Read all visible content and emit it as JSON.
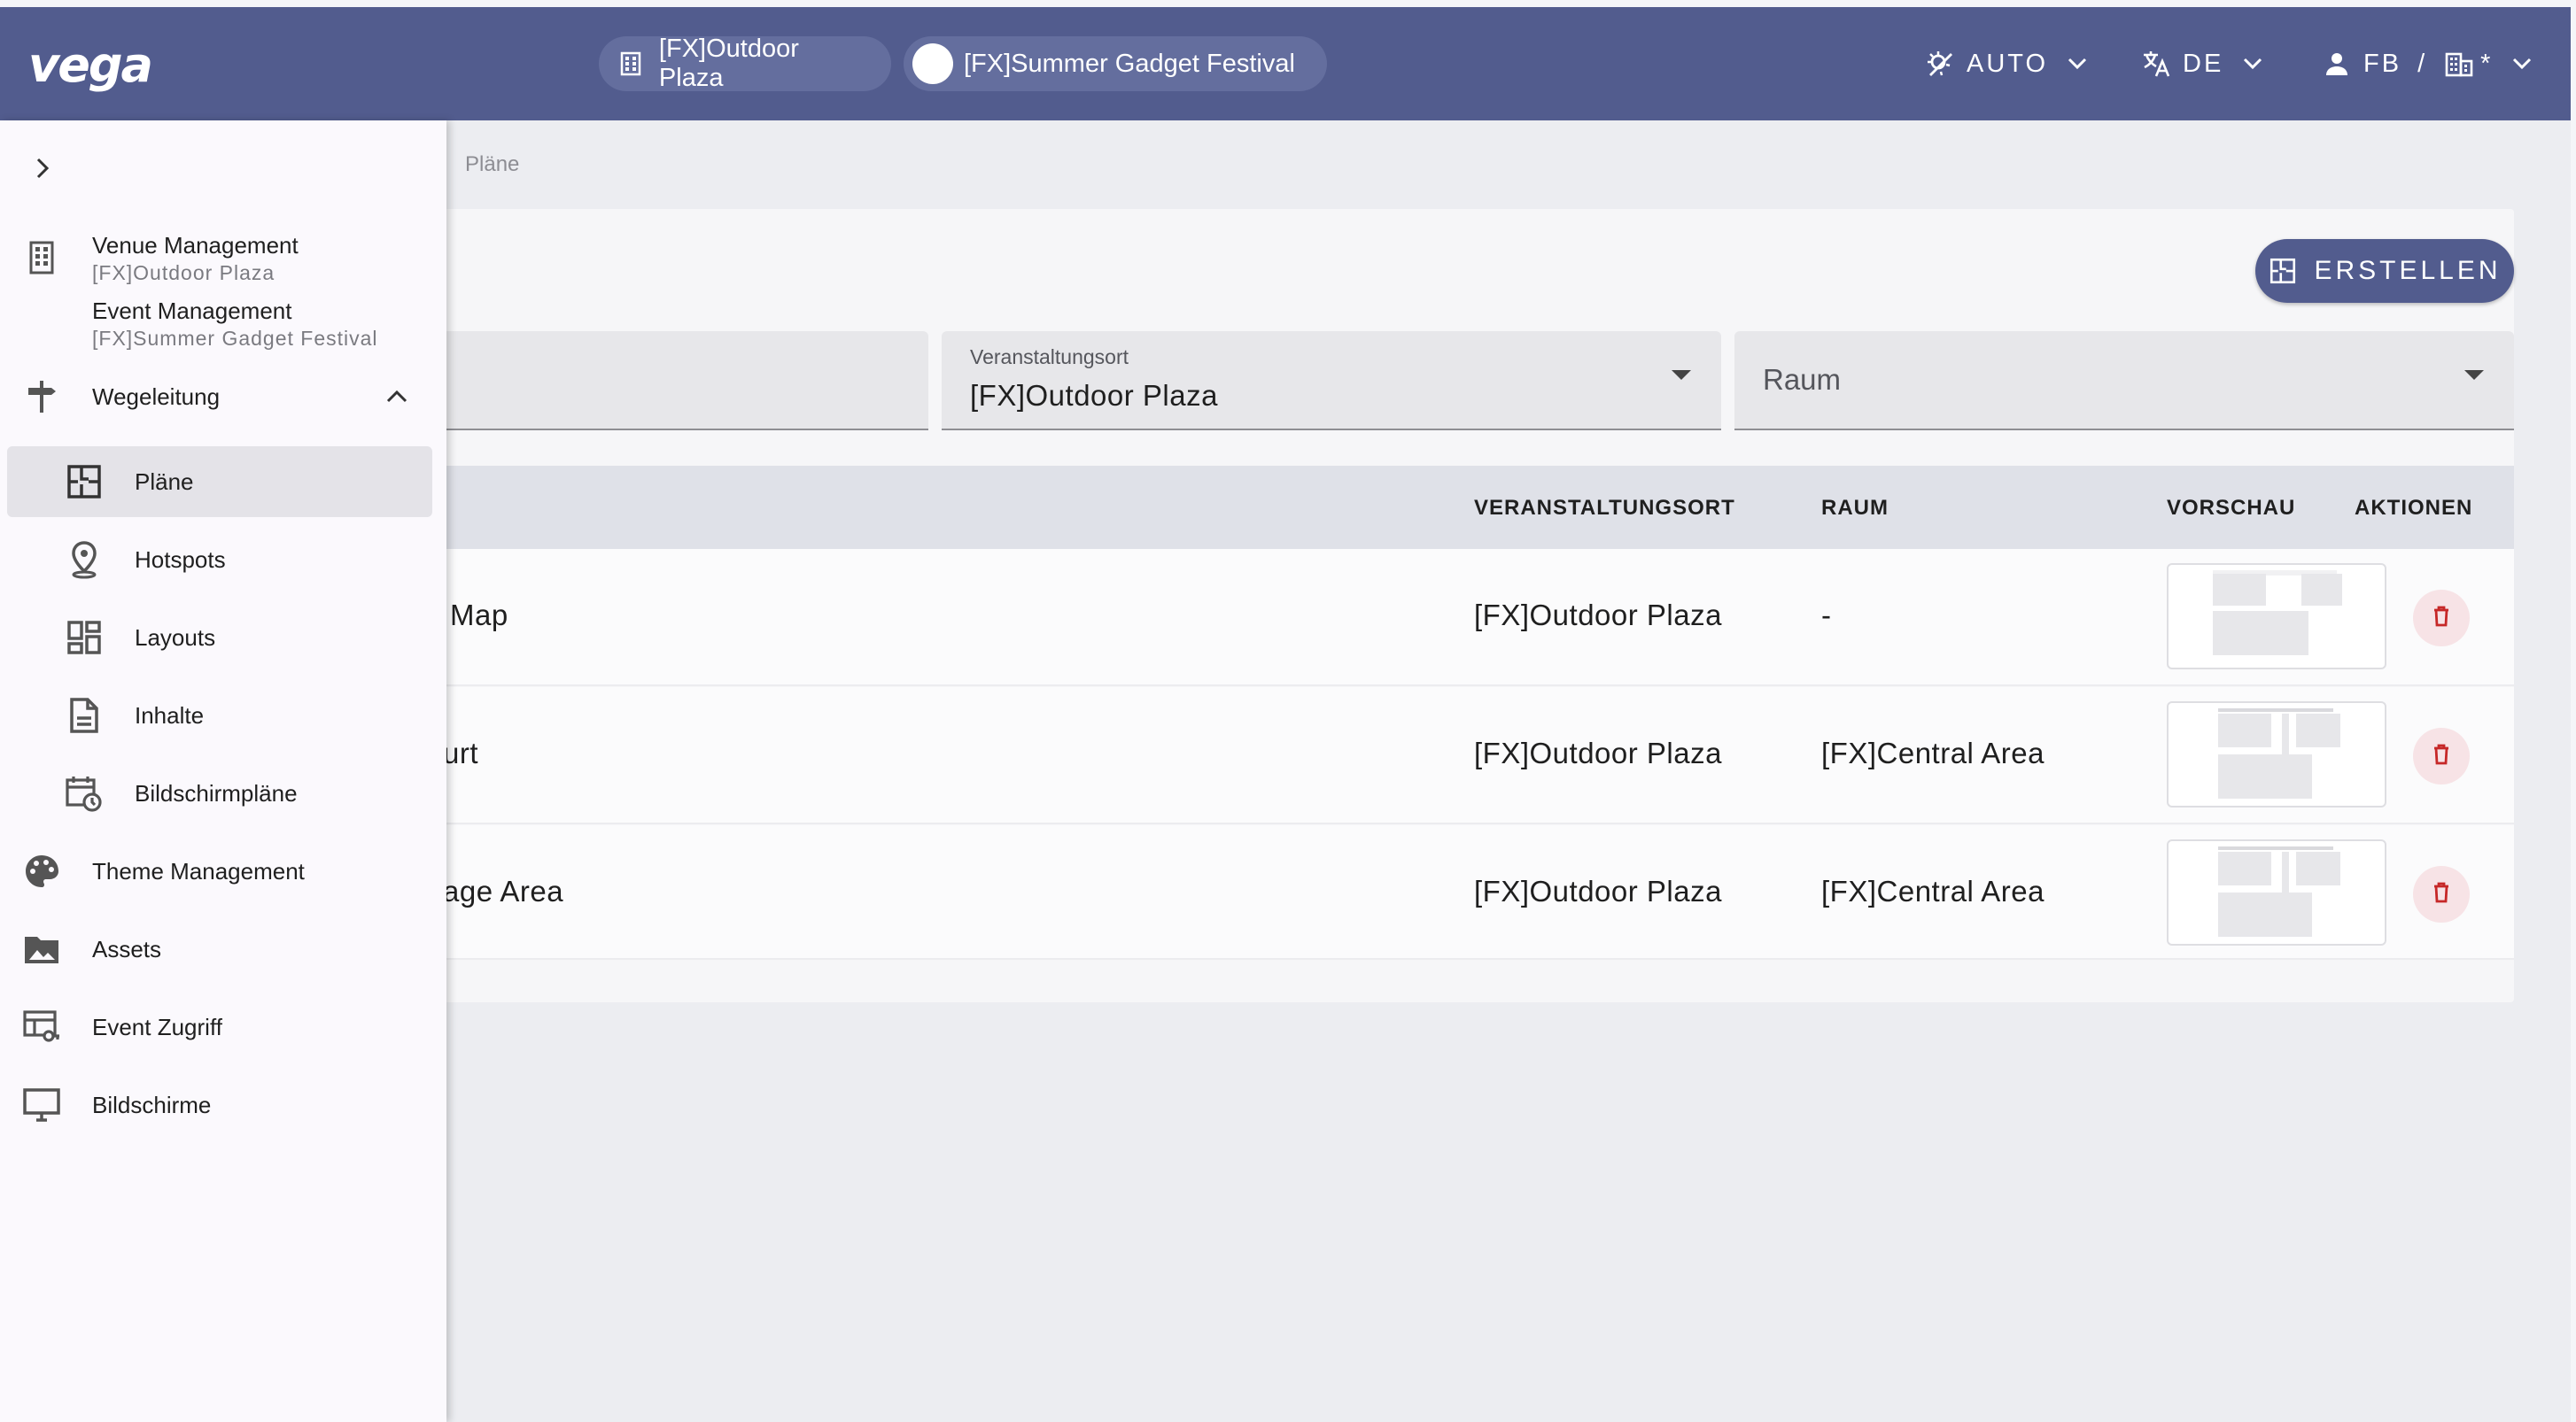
{
  "app": {
    "logo": "vega"
  },
  "header": {
    "venue_chip": "[FX]Outdoor Plaza",
    "event_chip": "[FX]Summer Gadget Festival",
    "theme_mode": "AUTO",
    "language": "DE",
    "user": "FB",
    "separator": "/",
    "tenant": "*"
  },
  "sidebar": {
    "venue_management": {
      "label": "Venue Management",
      "sub": "[FX]Outdoor Plaza"
    },
    "event_management": {
      "label": "Event Management",
      "sub": "[FX]Summer Gadget Festival"
    },
    "wayfinding": {
      "label": "Wegeleitung"
    },
    "sub_items": [
      {
        "label": "Pläne",
        "icon": "floorplan-icon"
      },
      {
        "label": "Hotspots",
        "icon": "map-pin-icon"
      },
      {
        "label": "Layouts",
        "icon": "dashboard-icon"
      },
      {
        "label": "Inhalte",
        "icon": "document-icon"
      },
      {
        "label": "Bildschirmpläne",
        "icon": "calendar-clock-icon"
      }
    ],
    "items": [
      {
        "label": "Theme Management",
        "icon": "palette-icon"
      },
      {
        "label": "Assets",
        "icon": "image-folder-icon"
      },
      {
        "label": "Event Zugriff",
        "icon": "access-icon"
      },
      {
        "label": "Bildschirme",
        "icon": "monitor-icon"
      }
    ]
  },
  "breadcrumb": "Pläne",
  "toolbar": {
    "create_label": "ERSTELLEN"
  },
  "filters": {
    "venue": {
      "label": "Veranstaltungsort",
      "value": "[FX]Outdoor Plaza"
    },
    "room": {
      "placeholder": "Raum"
    }
  },
  "table": {
    "columns": {
      "venue": "VERANSTALTUNGSORT",
      "room": "RAUM",
      "preview": "VORSCHAU",
      "actions": "AKTIONEN"
    },
    "rows": [
      {
        "name": "Map",
        "venue": "[FX]Outdoor Plaza",
        "room": "-"
      },
      {
        "name": "urt",
        "venue": "[FX]Outdoor Plaza",
        "room": "[FX]Central Area"
      },
      {
        "name": "age Area",
        "venue": "[FX]Outdoor Plaza",
        "room": "[FX]Central Area"
      }
    ]
  },
  "colors": {
    "primary": "#525c8e",
    "danger": "#c62828",
    "danger_bg": "#f7e3e6"
  }
}
